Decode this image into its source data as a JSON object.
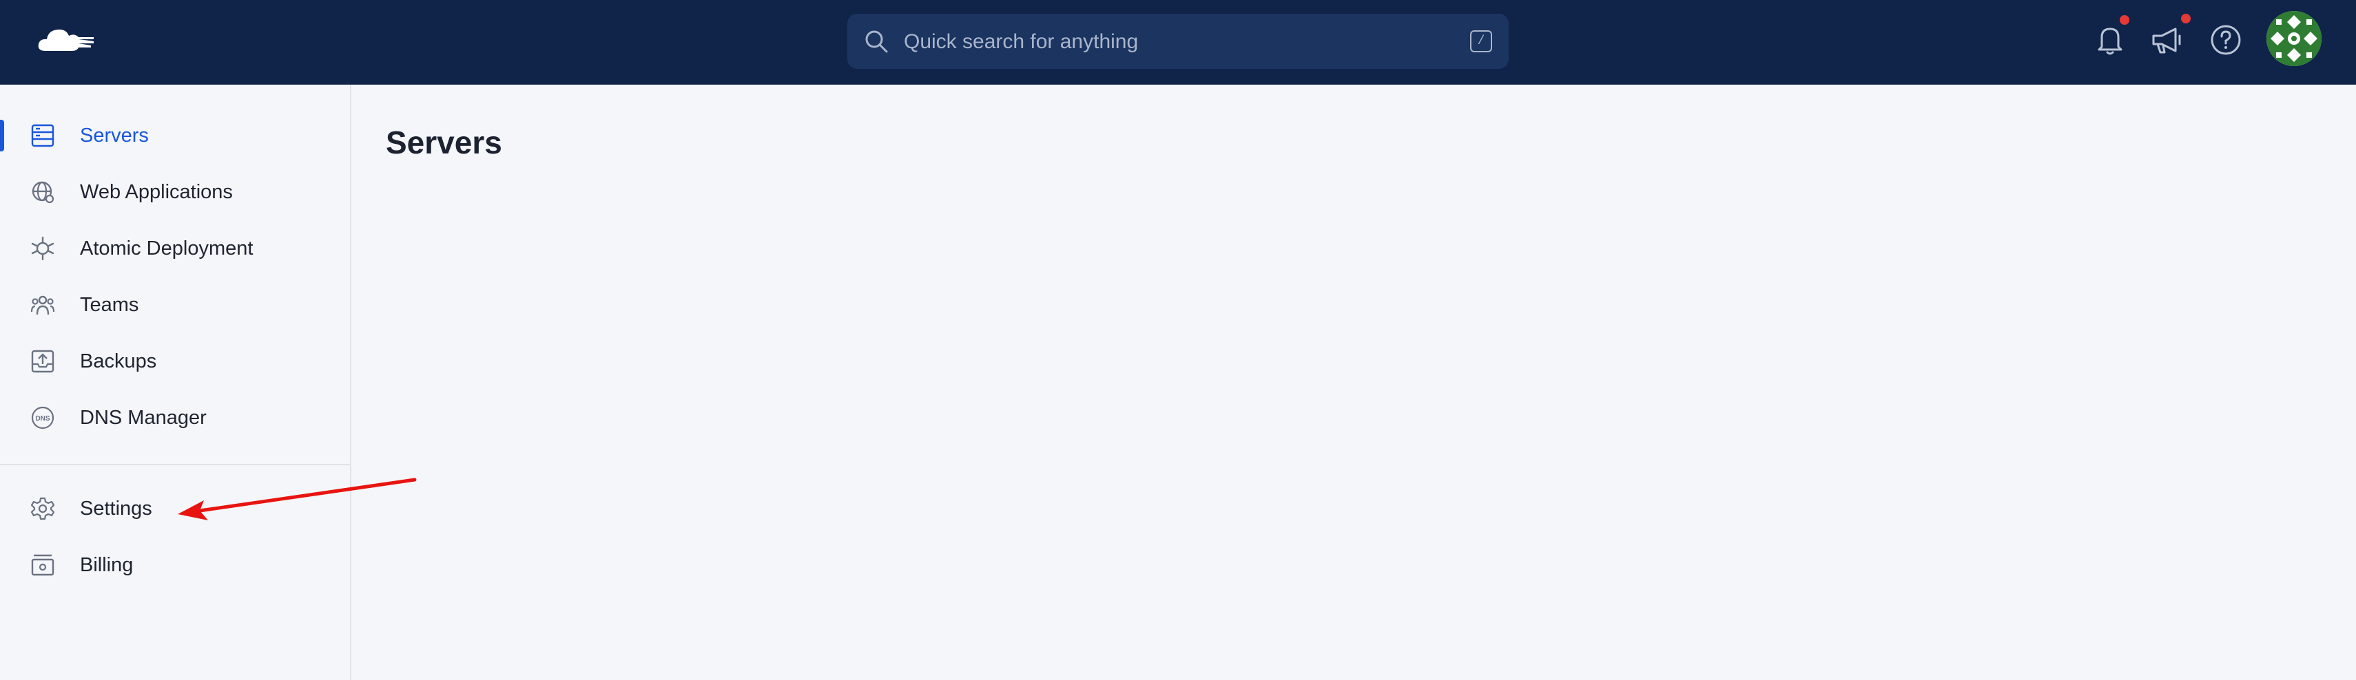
{
  "header": {
    "logo_icon": "cloud-logo-icon",
    "search": {
      "placeholder": "Quick search for anything",
      "shortcut": "/"
    },
    "icons": [
      "bell-icon",
      "megaphone-icon",
      "help-icon"
    ],
    "notification_dot_color": "#e53935",
    "background_color": "#10244a"
  },
  "sidebar": {
    "items": [
      {
        "label": "Servers",
        "icon": "server-icon",
        "active": true
      },
      {
        "label": "Web Applications",
        "icon": "globe-icon",
        "active": false
      },
      {
        "label": "Atomic Deployment",
        "icon": "atom-icon",
        "active": false
      },
      {
        "label": "Teams",
        "icon": "team-icon",
        "active": false
      },
      {
        "label": "Backups",
        "icon": "backup-icon",
        "active": false
      },
      {
        "label": "DNS Manager",
        "icon": "dns-icon",
        "active": false
      }
    ],
    "footer_items": [
      {
        "label": "Settings",
        "icon": "gear-icon"
      },
      {
        "label": "Billing",
        "icon": "billing-icon"
      }
    ],
    "accent_color": "#1a56db"
  },
  "main": {
    "title": "Servers"
  }
}
